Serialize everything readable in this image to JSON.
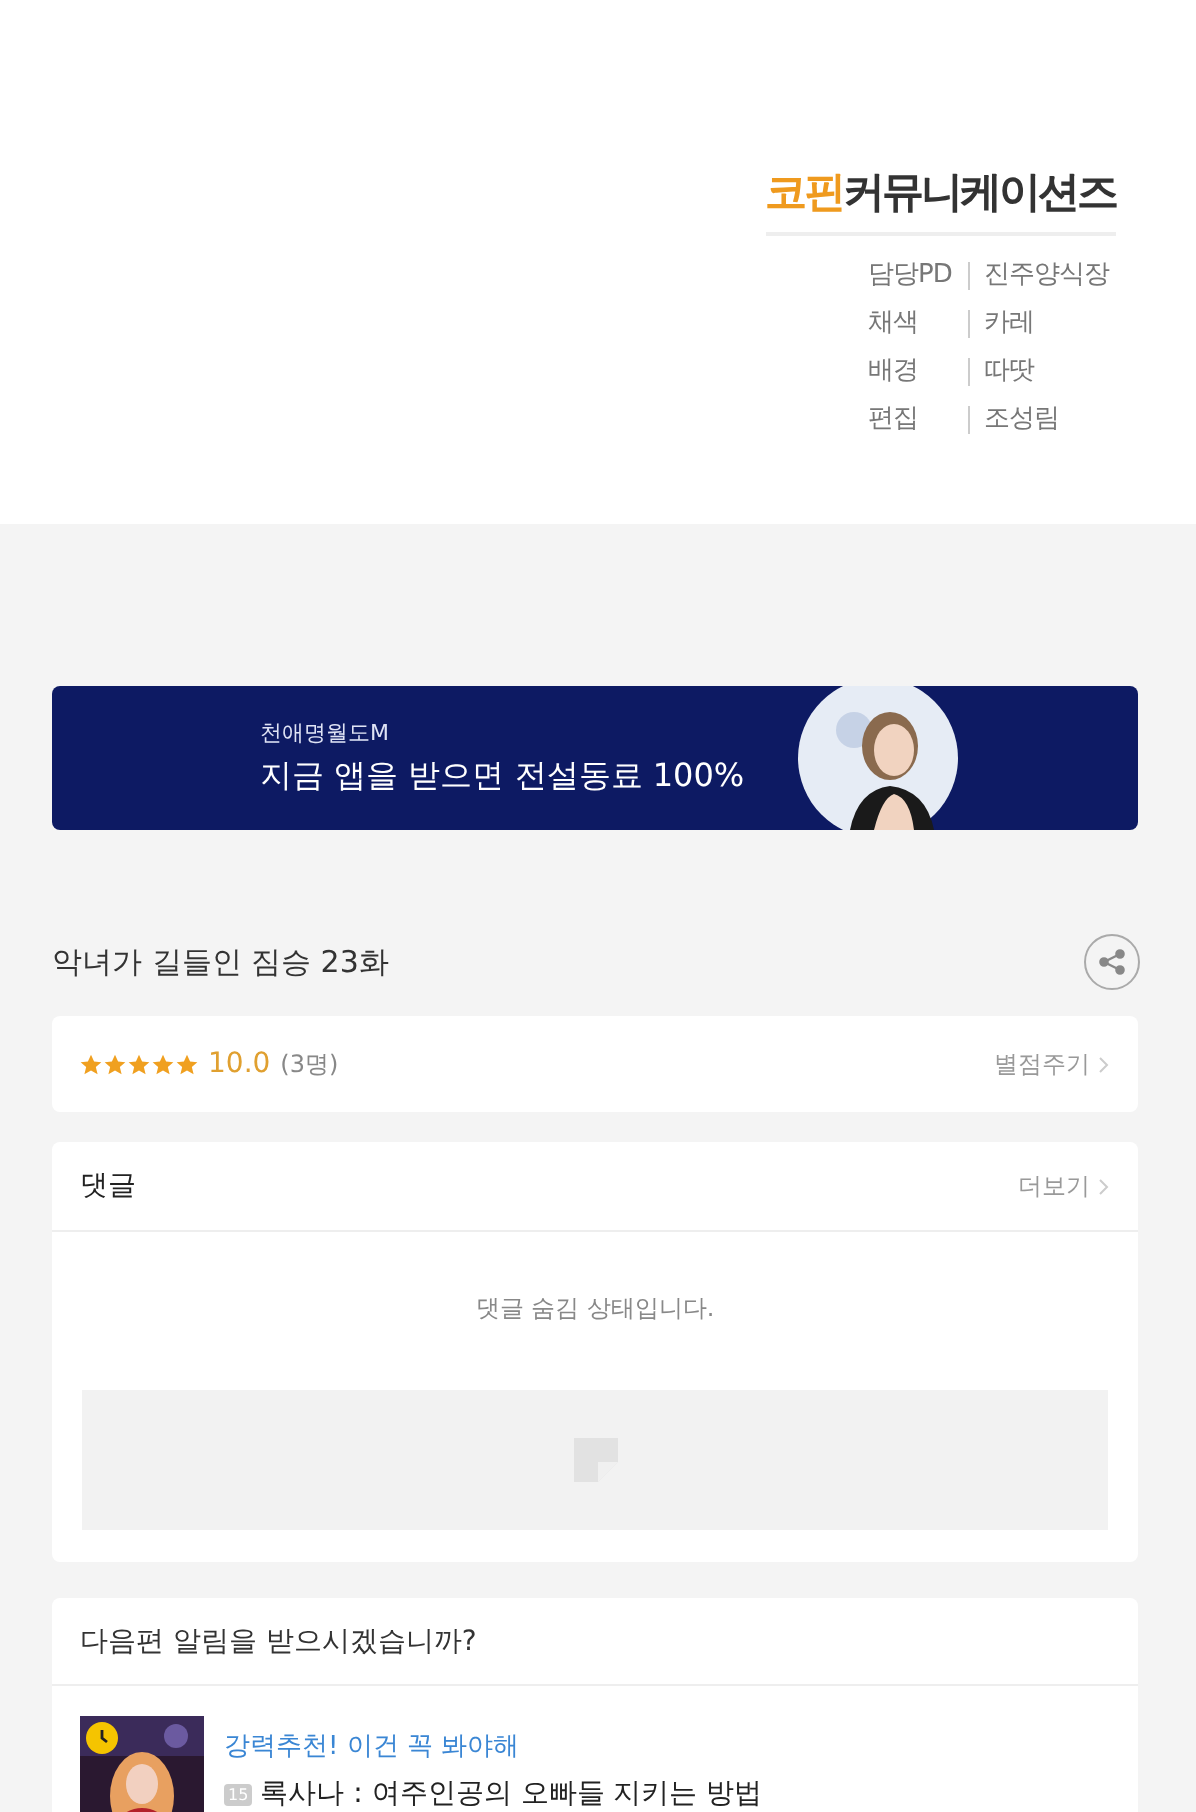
{
  "credits": {
    "logo_accent": "코핀",
    "logo_rest": "커뮤니케이션즈",
    "rows": [
      {
        "role": "담당PD",
        "name": "진주양식장"
      },
      {
        "role": "채색",
        "name": "카레"
      },
      {
        "role": "배경",
        "name": "따땃"
      },
      {
        "role": "편집",
        "name": "조성림"
      }
    ]
  },
  "banner": {
    "kind": "picture",
    "subtitle": "천애명월도M",
    "headline": "지금 앱을 받으면 전설동료 100%"
  },
  "episode": {
    "title": "악녀가 길들인 짐승 23화"
  },
  "rating": {
    "stars": 5,
    "score": "10.0",
    "count": "(3명)",
    "action": "별점주기"
  },
  "comments": {
    "title": "댓글",
    "more": "더보기",
    "hidden_message": "댓글 숨김 상태입니다."
  },
  "next": {
    "question": "다음편 알림을 받으시겠습니까?",
    "recommendation": {
      "tag": "강력추천! 이건 꼭 봐야해",
      "age": "15",
      "title": "록사나 : 여주인공의 오빠들 지키는 방법"
    }
  }
}
